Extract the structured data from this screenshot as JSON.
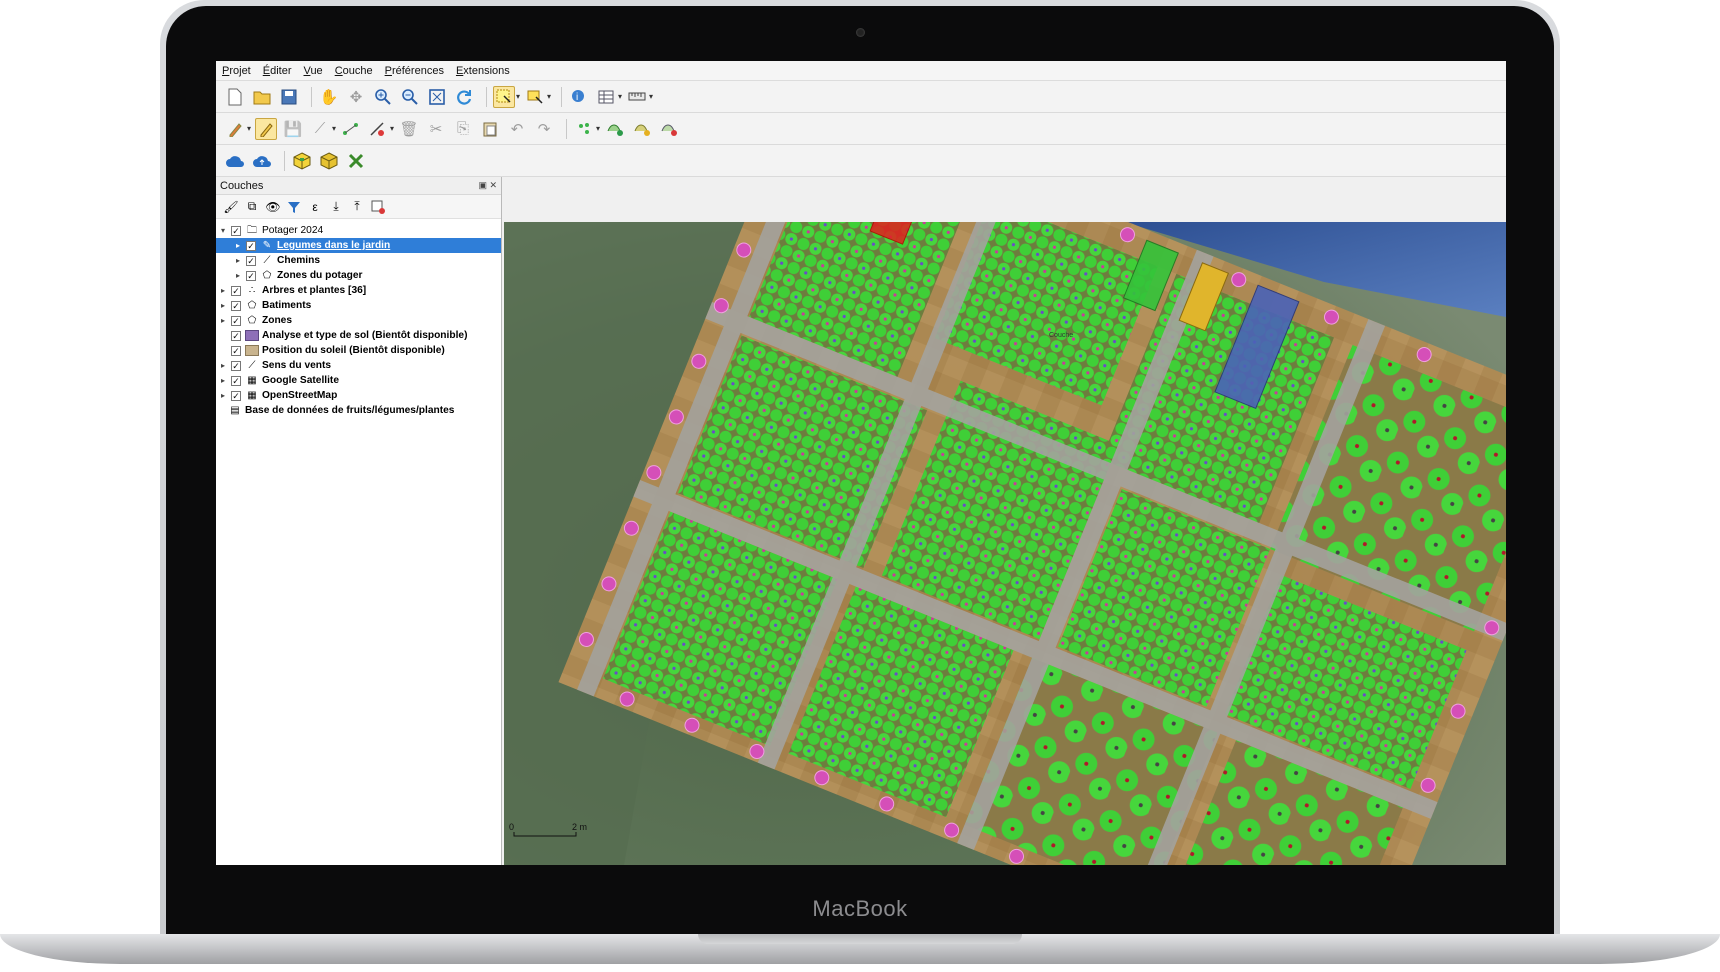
{
  "device": {
    "brand_label": "MacBook"
  },
  "menu": [
    "Projet",
    "Éditer",
    "Vue",
    "Couche",
    "Préférences",
    "Extensions"
  ],
  "toolbars": {
    "row1": [
      "new-file-icon",
      "open-folder-icon",
      "save-icon",
      "pan-hand-icon",
      "pan-to-selection-icon",
      "zoom-in-icon",
      "zoom-out-icon",
      "zoom-full-icon",
      "refresh-icon",
      "select-features-icon",
      "select-by-polygon-icon",
      "identify-icon",
      "attribute-table-icon",
      "measure-icon"
    ],
    "row2": [
      "current-edits-icon",
      "toggle-editing-icon",
      "save-edits-icon",
      "digitize-icon",
      "add-feature-icon",
      "vertex-tool-icon",
      "delete-feature-icon",
      "cut-icon",
      "copy-icon",
      "paste-icon",
      "undo-icon",
      "redo-icon",
      "add-point-icon",
      "add-line-icon",
      "add-polygon-icon",
      "remove-layer-icon"
    ],
    "row3": [
      "cloud-icon",
      "cloud-upload-icon",
      "package-icon",
      "package-alt-icon",
      "tools-icon"
    ]
  },
  "layers_panel": {
    "title": "Couches",
    "items": [
      {
        "label": "Potager 2024",
        "indent": 0,
        "expand": "▾",
        "checked": true,
        "icon": "group-icon",
        "bold": false
      },
      {
        "label": "Legumes dans le jardin",
        "indent": 1,
        "expand": "▸",
        "checked": true,
        "icon": "pencil-icon",
        "bold": true,
        "selected": true
      },
      {
        "label": "Chemins",
        "indent": 1,
        "expand": "▸",
        "checked": true,
        "icon": "line-icon",
        "bold": true
      },
      {
        "label": "Zones du potager",
        "indent": 1,
        "expand": "▸",
        "checked": true,
        "icon": "polygon-icon",
        "bold": true
      },
      {
        "label": "Arbres et plantes [36]",
        "indent": 0,
        "expand": "▸",
        "checked": true,
        "icon": "points-icon",
        "bold": true
      },
      {
        "label": "Batiments",
        "indent": 0,
        "expand": "▸",
        "checked": true,
        "icon": "polygon-icon",
        "bold": true
      },
      {
        "label": "Zones",
        "indent": 0,
        "expand": "▸",
        "checked": true,
        "icon": "polygon-icon",
        "bold": true
      },
      {
        "label": "Analyse et type de sol (Bientôt disponible)",
        "indent": 0,
        "expand": "",
        "checked": true,
        "icon": "swatch-purple",
        "bold": true
      },
      {
        "label": "Position du soleil (Bientôt disponible)",
        "indent": 0,
        "expand": "",
        "checked": true,
        "icon": "swatch-tan",
        "bold": true
      },
      {
        "label": "Sens du vents",
        "indent": 0,
        "expand": "▸",
        "checked": true,
        "icon": "line-icon",
        "bold": true
      },
      {
        "label": "Google Satellite",
        "indent": 0,
        "expand": "▸",
        "checked": true,
        "icon": "raster-icon",
        "bold": true
      },
      {
        "label": "OpenStreetMap",
        "indent": 0,
        "expand": "▸",
        "checked": true,
        "icon": "raster-icon",
        "bold": true
      },
      {
        "label": "Base de données de fruits/légumes/plantes",
        "indent": 0,
        "expand": "",
        "checked": null,
        "icon": "table-icon",
        "bold": true
      }
    ]
  },
  "map": {
    "building_label": "Couche",
    "scale_start": "0",
    "scale_end": "2 m",
    "colors": {
      "plant": "#3fd13a",
      "path": "#9e9e9a",
      "soil": "#b48a4c",
      "marker": "#d54fb8",
      "water": "#4b63b8",
      "selection": "#e3201f",
      "building": "#e0b52c"
    }
  }
}
